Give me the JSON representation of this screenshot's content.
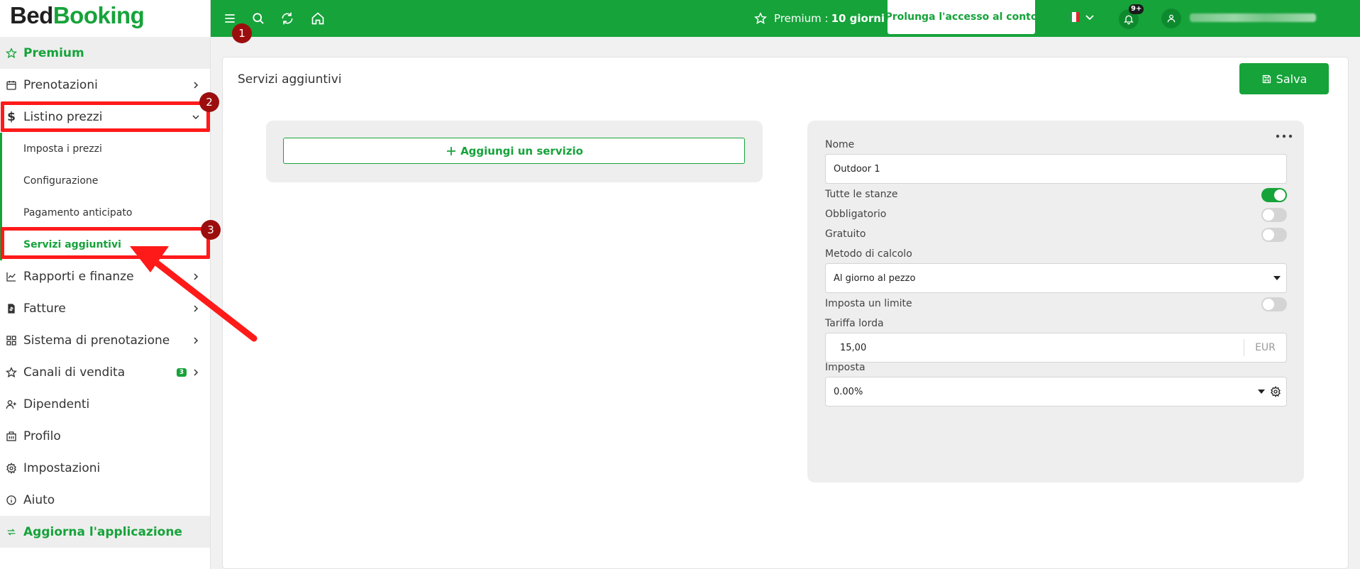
{
  "brand": {
    "part1": "Bed",
    "part2": "Booking"
  },
  "sidebar": {
    "items": [
      {
        "label": "Premium"
      },
      {
        "label": "Prenotazioni"
      },
      {
        "label": "Listino prezzi"
      },
      {
        "label": "Rapporti e finanze"
      },
      {
        "label": "Fatture"
      },
      {
        "label": "Sistema di prenotazione"
      },
      {
        "label": "Canali di vendita",
        "badge": "3"
      },
      {
        "label": "Dipendenti"
      },
      {
        "label": "Profilo"
      },
      {
        "label": "Impostazioni"
      },
      {
        "label": "Aiuto"
      },
      {
        "label": "Aggiorna l'applicazione"
      }
    ],
    "subitems": [
      {
        "label": "Imposta i prezzi"
      },
      {
        "label": "Configurazione"
      },
      {
        "label": "Pagamento anticipato"
      },
      {
        "label": "Servizi aggiuntivi"
      }
    ]
  },
  "topbar": {
    "premium_label": "Premium :",
    "premium_value": "10 giorni",
    "extend_button": "Prolunga l'accesso al conto",
    "notification_badge": "9+",
    "language": "IT"
  },
  "page": {
    "title": "Servizi aggiuntivi",
    "save_button": "Salva",
    "add_service_button": "Aggiungi un servizio"
  },
  "form": {
    "name_label": "Nome",
    "name_value": "Outdoor 1",
    "all_rooms_label": "Tutte le stanze",
    "all_rooms_on": true,
    "mandatory_label": "Obbligatorio",
    "mandatory_on": false,
    "free_label": "Gratuito",
    "free_on": false,
    "calc_method_label": "Metodo di calcolo",
    "calc_method_value": "Al giorno al pezzo",
    "limit_label": "Imposta un limite",
    "limit_on": false,
    "gross_rate_label": "Tariffa lorda",
    "gross_rate_value": "15,00",
    "currency": "EUR",
    "tax_label": "Imposta",
    "tax_value": "0.00%"
  },
  "annotations": {
    "markers": [
      "1",
      "2",
      "3"
    ]
  },
  "colors": {
    "primary": "#16a33a",
    "annotation": "#ff1a1a",
    "marker": "#9c0e0e"
  }
}
